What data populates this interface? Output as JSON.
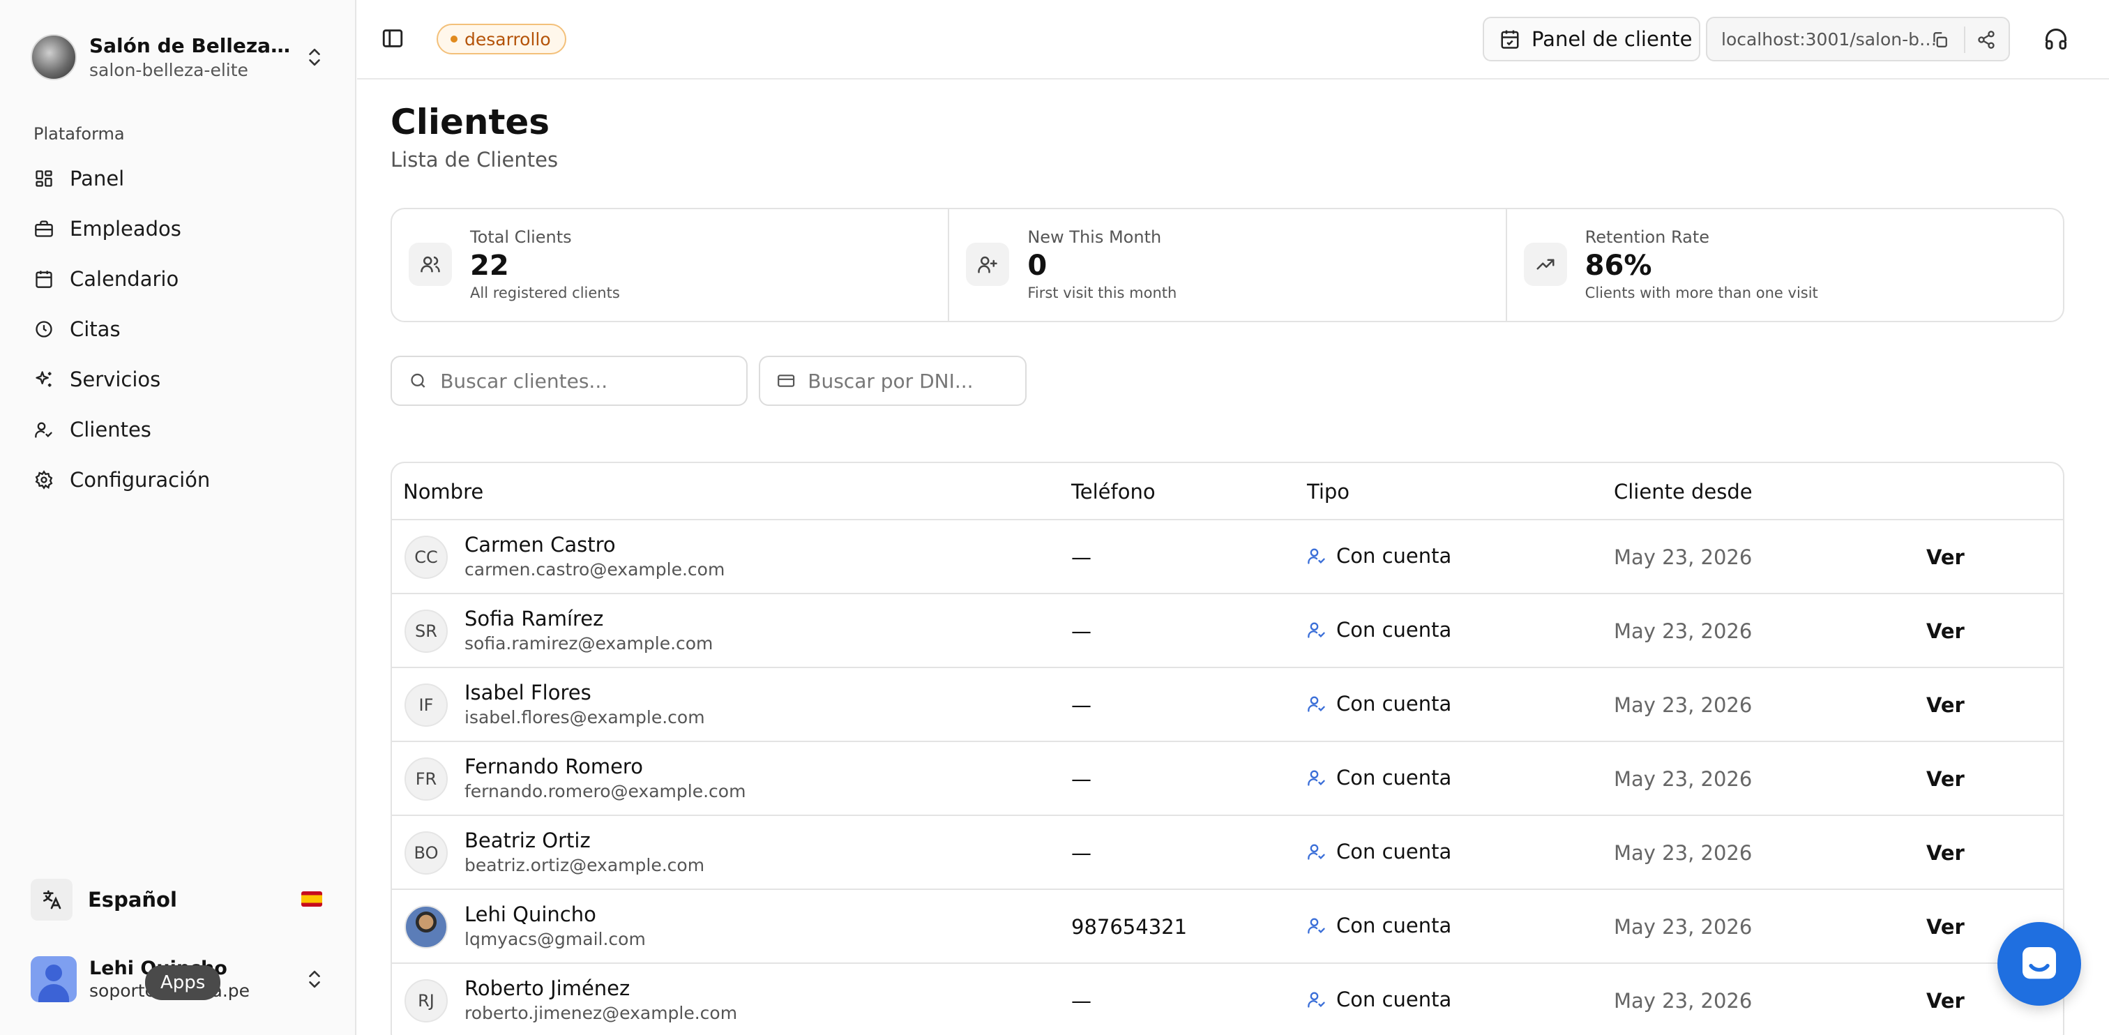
{
  "workspace": {
    "name": "Salón de Belleza Eli...",
    "slug": "salon-belleza-elite"
  },
  "sidebar": {
    "section_label": "Plataforma",
    "items": [
      {
        "label": "Panel",
        "icon": "dashboard-icon"
      },
      {
        "label": "Empleados",
        "icon": "briefcase-icon"
      },
      {
        "label": "Calendario",
        "icon": "calendar-icon"
      },
      {
        "label": "Citas",
        "icon": "clock-icon"
      },
      {
        "label": "Servicios",
        "icon": "sparkles-icon"
      },
      {
        "label": "Clientes",
        "icon": "user-check-icon"
      },
      {
        "label": "Configuración",
        "icon": "gear-icon"
      }
    ],
    "language": {
      "label": "Español",
      "flag": "spain-flag-icon"
    },
    "user": {
      "name": "Lehi Quincho",
      "email": "soporte@...nda.pe"
    },
    "tooltip": "Apps"
  },
  "topbar": {
    "env_badge": "desarrollo",
    "panel_button": "Panel de cliente",
    "url": "localhost:3001/salon-bell..."
  },
  "page": {
    "title": "Clientes",
    "subtitle": "Lista de Clientes"
  },
  "stats": [
    {
      "label": "Total Clients",
      "value": "22",
      "desc": "All registered clients",
      "icon": "users-icon"
    },
    {
      "label": "New This Month",
      "value": "0",
      "desc": "First visit this month",
      "icon": "user-plus-icon"
    },
    {
      "label": "Retention Rate",
      "value": "86%",
      "desc": "Clients with more than one visit",
      "icon": "trending-up-icon"
    }
  ],
  "search": {
    "name_placeholder": "Buscar clientes...",
    "dni_placeholder": "Buscar por DNI..."
  },
  "table": {
    "columns": {
      "name": "Nombre",
      "phone": "Teléfono",
      "type": "Tipo",
      "since": "Cliente desde"
    },
    "rows": [
      {
        "initials": "CC",
        "name": "Carmen Castro",
        "email": "carmen.castro@example.com",
        "phone": "—",
        "type": "Con cuenta",
        "since": "May 23, 2026",
        "action": "Ver"
      },
      {
        "initials": "SR",
        "name": "Sofia Ramírez",
        "email": "sofia.ramirez@example.com",
        "phone": "—",
        "type": "Con cuenta",
        "since": "May 23, 2026",
        "action": "Ver"
      },
      {
        "initials": "IF",
        "name": "Isabel Flores",
        "email": "isabel.flores@example.com",
        "phone": "—",
        "type": "Con cuenta",
        "since": "May 23, 2026",
        "action": "Ver"
      },
      {
        "initials": "FR",
        "name": "Fernando Romero",
        "email": "fernando.romero@example.com",
        "phone": "—",
        "type": "Con cuenta",
        "since": "May 23, 2026",
        "action": "Ver"
      },
      {
        "initials": "BO",
        "name": "Beatriz Ortiz",
        "email": "beatriz.ortiz@example.com",
        "phone": "—",
        "type": "Con cuenta",
        "since": "May 23, 2026",
        "action": "Ver"
      },
      {
        "initials": "",
        "name": "Lehi Quincho",
        "email": "lqmyacs@gmail.com",
        "phone": "987654321",
        "type": "Con cuenta",
        "since": "May 23, 2026",
        "action": "Ver"
      },
      {
        "initials": "RJ",
        "name": "Roberto Jiménez",
        "email": "roberto.jimenez@example.com",
        "phone": "—",
        "type": "Con cuenta",
        "since": "May 23, 2026",
        "action": "Ver"
      }
    ]
  }
}
